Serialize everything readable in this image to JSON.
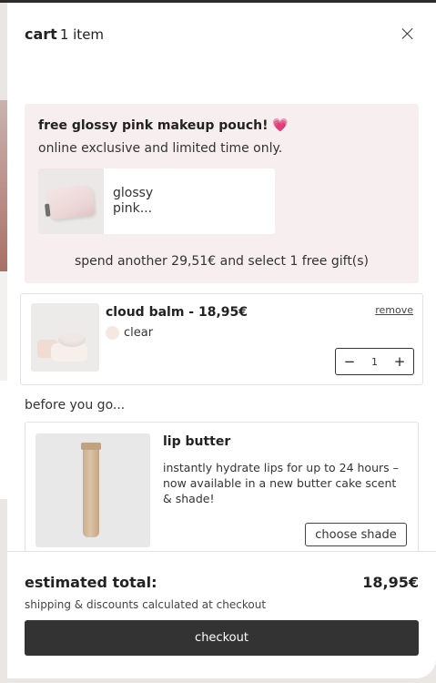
{
  "header": {
    "title": "cart",
    "count": "1 item",
    "close_icon": "close-icon"
  },
  "promo": {
    "title": "free glossy pink makeup pouch! 💗",
    "subtitle": "online exclusive and limited time only.",
    "gift_name": "glossy pink...",
    "spend_text": "spend another 29,51€ and select 1 free gift(s)"
  },
  "cart_item": {
    "name": "cloud balm - 18,95€",
    "variant": "clear",
    "remove_label": "remove",
    "quantity": "1",
    "decrement_icon": "minus-icon",
    "increment_icon": "plus-icon"
  },
  "recommendations": {
    "heading": "before you go...",
    "items": [
      {
        "title": "lip butter",
        "description": "instantly hydrate lips for up to 24 hours – now available in a new butter cake scent & shade!",
        "button_label": "choose shade"
      }
    ]
  },
  "footer": {
    "total_label": "estimated total:",
    "total_value": "18,95€",
    "shipping_note": "shipping & discounts calculated at checkout",
    "checkout_label": "checkout"
  },
  "colors": {
    "promo_bg": "#f7eeef",
    "checkout_bg": "#333333",
    "swatch_clear": "#f4e8e0"
  }
}
